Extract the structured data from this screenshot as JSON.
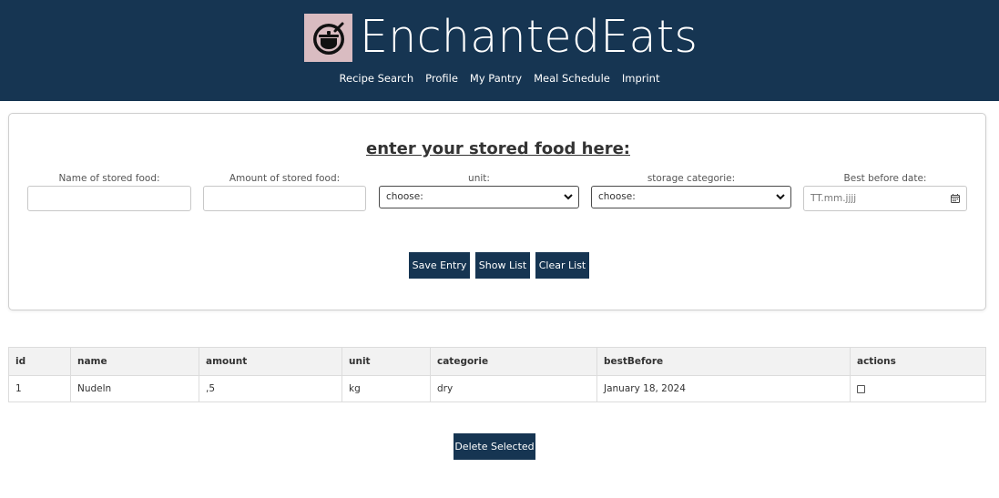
{
  "header": {
    "site_title": "EnchantedEats",
    "nav": [
      "Recipe Search",
      "Profile",
      "My Pantry",
      "Meal Schedule",
      "Imprint"
    ]
  },
  "form": {
    "heading": "enter your stored food here:",
    "fields": {
      "name": {
        "label": "Name of stored food:",
        "value": ""
      },
      "amount": {
        "label": "Amount of stored food:",
        "value": ""
      },
      "unit": {
        "label": "unit:",
        "selected": "choose:"
      },
      "category": {
        "label": "storage categorie:",
        "selected": "choose:"
      },
      "best_before": {
        "label": "Best before date:",
        "placeholder": "TT.mm.jjjj"
      }
    },
    "buttons": {
      "save": "Save Entry",
      "show": "Show List",
      "clear": "Clear List"
    }
  },
  "table": {
    "columns": [
      "id",
      "name",
      "amount",
      "unit",
      "categorie",
      "bestBefore",
      "actions"
    ],
    "rows": [
      {
        "id": "1",
        "name": "Nudeln",
        "amount": ",5",
        "unit": "kg",
        "categorie": "dry",
        "bestBefore": "January 18, 2024",
        "selected": false
      }
    ]
  },
  "delete_button": "Delete Selected",
  "colors": {
    "header_bg": "#163552",
    "button_bg": "#163552",
    "logo_bg": "#d9bcc1"
  },
  "icons": {
    "logo": "cooking-pot-icon",
    "select": "chevron-down-icon",
    "date": "calendar-icon"
  }
}
